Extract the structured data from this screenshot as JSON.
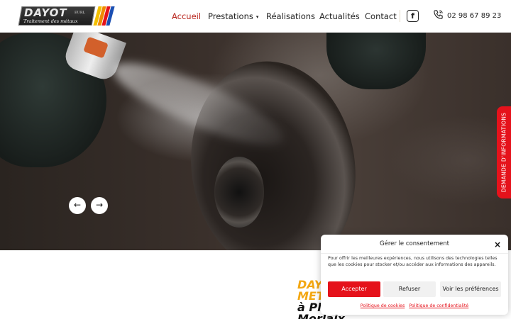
{
  "header": {
    "logo": {
      "name": "DAYOT",
      "legal": "EURL",
      "tagline": "Traitement des métaux"
    },
    "nav": [
      {
        "label": "Accueil",
        "active": true
      },
      {
        "label": "Prestations",
        "has_dropdown": true
      },
      {
        "label": "Réalisations"
      },
      {
        "label": "Actualités"
      },
      {
        "label": "Contact"
      }
    ],
    "social": {
      "icon": "facebook-icon",
      "glyph": "f"
    },
    "phone": {
      "icon": "phone-icon",
      "number": "02 98 67 89 23"
    }
  },
  "hero": {
    "prev_glyph": "←",
    "next_glyph": "→",
    "side_tab": "DEMANDE D'INFORMATIONS"
  },
  "content": {
    "title_lines": [
      "DAY",
      "MET",
      "à Pl",
      "Morlaix"
    ]
  },
  "cookie": {
    "title": "Gérer le consentement",
    "close_glyph": "×",
    "text": "Pour offrir les meilleures expériences, nous utilisons des technologies telles que les cookies pour stocker et/ou accéder aux informations des appareils.",
    "accept": "Accepter",
    "refuse": "Refuser",
    "preferences": "Voir les préférences",
    "links": [
      "Politique de cookies",
      "Politique de confidentialité"
    ]
  },
  "colors": {
    "accent_red": "#e5121b",
    "active_nav": "#b8231b",
    "title_yellow": "#f3a712",
    "logo_stripes": [
      "#f3c000",
      "#f08a00",
      "#e5121b",
      "#1a4fb3"
    ]
  }
}
